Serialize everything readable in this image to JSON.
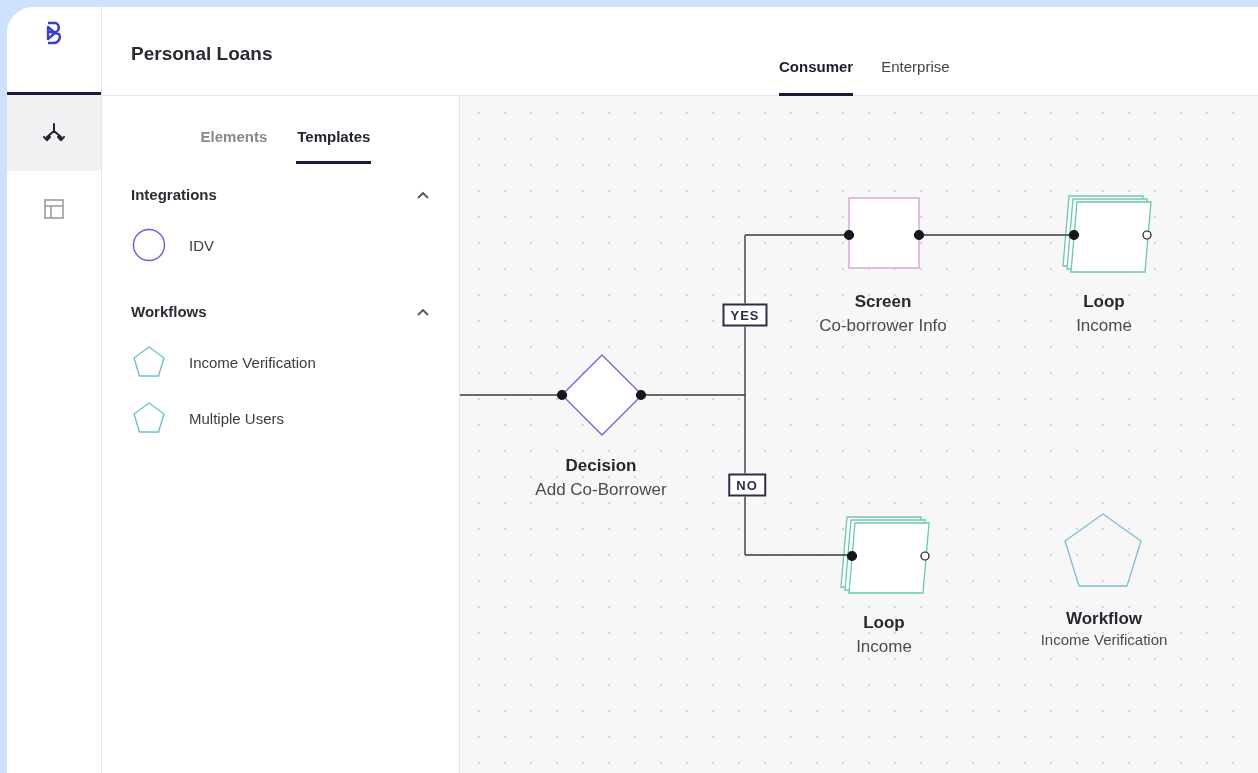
{
  "app": {
    "title": "Personal Loans"
  },
  "header_tabs": [
    {
      "label": "Consumer",
      "selected": true
    },
    {
      "label": "Enterprise",
      "selected": false
    }
  ],
  "rail": [
    {
      "kind": "flow",
      "selected": true
    },
    {
      "kind": "layout",
      "selected": false
    }
  ],
  "panel_tabs": [
    {
      "label": "Elements",
      "selected": false
    },
    {
      "label": "Templates",
      "selected": true
    }
  ],
  "sections": [
    {
      "title": "Integrations",
      "expanded": true,
      "items": [
        {
          "label": "IDV",
          "kind": "integration"
        }
      ]
    },
    {
      "title": "Workflows",
      "expanded": true,
      "items": [
        {
          "label": "Income Verification",
          "kind": "workflow"
        },
        {
          "label": "Multiple Users",
          "kind": "workflow"
        }
      ]
    }
  ],
  "canvas": {
    "nodes": [
      {
        "kind": "decision",
        "title": "Decision",
        "subtitle": "Add Co-Borrower"
      },
      {
        "kind": "screen",
        "title": "Screen",
        "subtitle": "Co-borrower Info"
      },
      {
        "kind": "loop",
        "title": "Loop",
        "subtitle": "Income"
      },
      {
        "kind": "loop",
        "title": "Loop",
        "subtitle": "Income"
      },
      {
        "kind": "workflow",
        "title": "Workflow",
        "subtitle": "Income Verification"
      }
    ],
    "branches": [
      {
        "label": "YES"
      },
      {
        "label": "NO"
      }
    ]
  }
}
